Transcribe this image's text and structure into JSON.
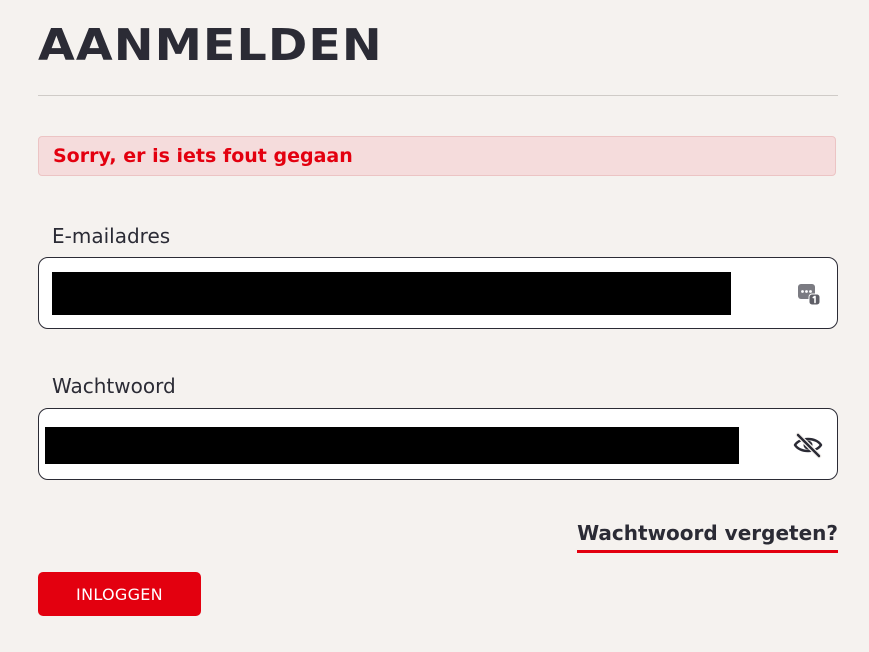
{
  "page": {
    "title": "AANMELDEN"
  },
  "alert": {
    "message": "Sorry, er is iets fout gegaan",
    "color": "#e3000f",
    "background": "#f5dcdc"
  },
  "form": {
    "email": {
      "label": "E-mailadres",
      "value": "",
      "icon": "autofill-icon"
    },
    "password": {
      "label": "Wachtwoord",
      "value": "",
      "icon": "eye-slash-icon"
    },
    "forgot_link": "Wachtwoord vergeten?",
    "submit_label": "INLOGGEN"
  },
  "colors": {
    "accent": "#e3000f",
    "text": "#2b2b35",
    "background": "#f5f2ef"
  }
}
